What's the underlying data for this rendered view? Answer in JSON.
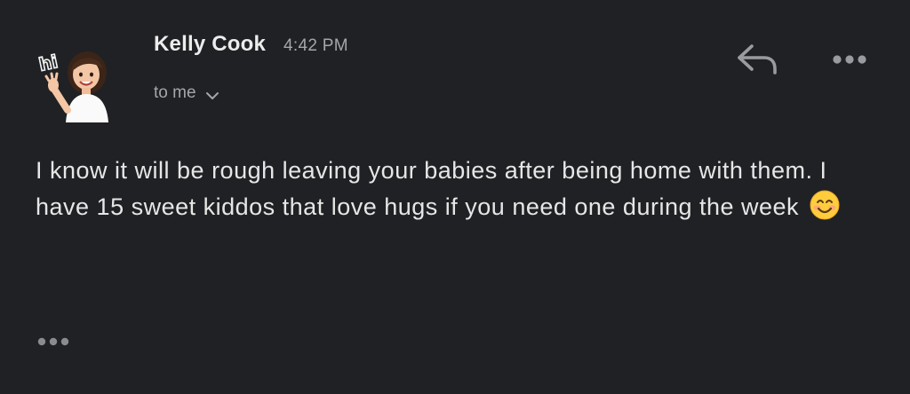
{
  "message": {
    "sender_name": "Kelly Cook",
    "timestamp": "4:42 PM",
    "recipient_label": "to me",
    "body": "I know it will be rough leaving your babies after being home with them. I have 15 sweet kiddos that love hugs if you need one during the week",
    "body_emoji": "smiling-face-with-smiling-eyes"
  },
  "avatar": {
    "type": "memoji",
    "description_icon": "waving-memoji-avatar",
    "badge_text": "hi"
  },
  "actions": {
    "reply_icon": "reply-arrow-icon",
    "more_icon": "more-horizontal-icon",
    "trimmed_content_icon": "ellipsis-icon"
  },
  "colors": {
    "background": "#202124",
    "primary_text": "#e8e8e8",
    "secondary_text": "#a5a6aa",
    "icon": "#9a9ba0"
  }
}
